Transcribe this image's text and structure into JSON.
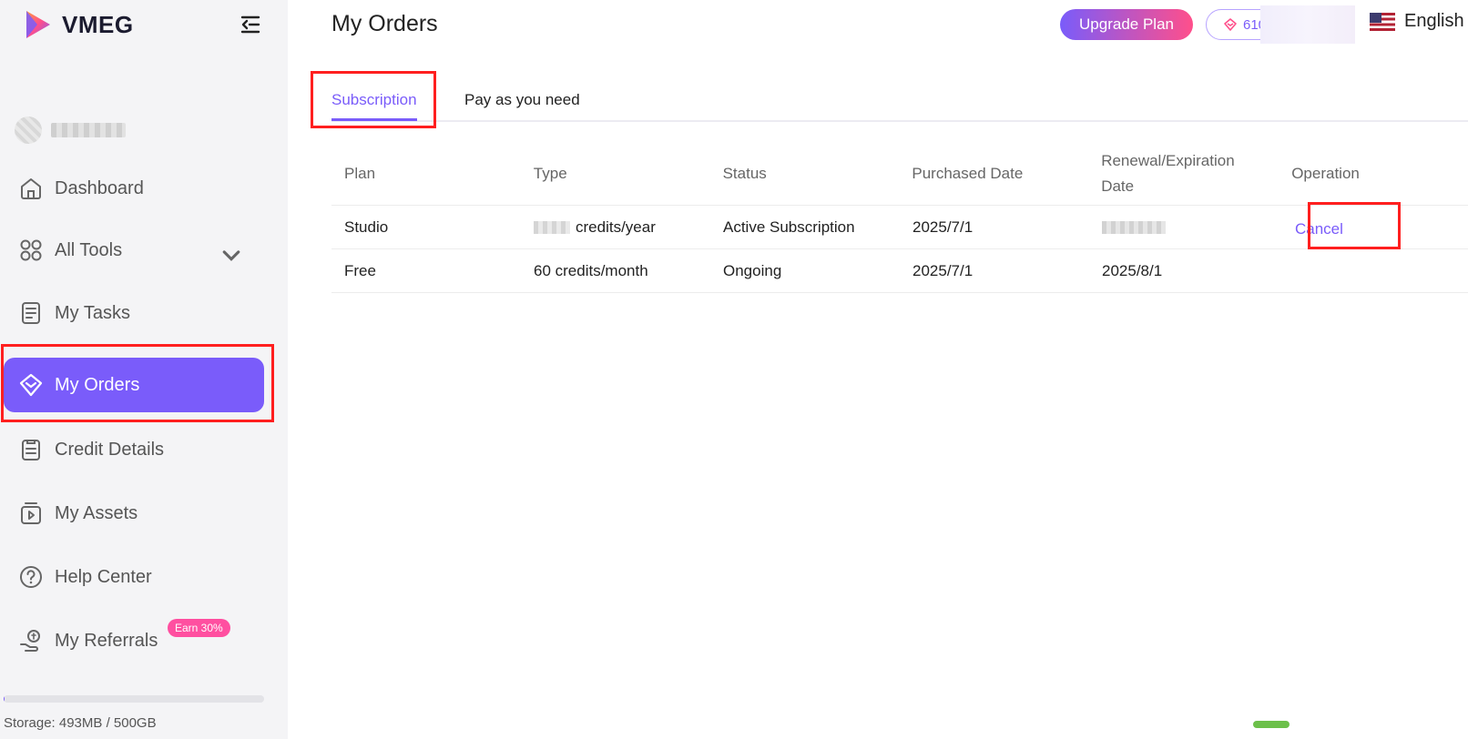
{
  "app": {
    "name": "VMEG"
  },
  "sidebar": {
    "items": [
      {
        "label": "Dashboard",
        "icon": "home-icon"
      },
      {
        "label": "All Tools",
        "icon": "grid-icon"
      },
      {
        "label": "My Tasks",
        "icon": "tasks-icon"
      },
      {
        "label": "My Orders",
        "icon": "diamond-icon",
        "active": true
      },
      {
        "label": "Credit Details",
        "icon": "clipboard-icon"
      },
      {
        "label": "My Assets",
        "icon": "media-icon"
      },
      {
        "label": "Help Center",
        "icon": "help-icon"
      },
      {
        "label": "My Referrals",
        "icon": "referral-icon",
        "badge": "Earn 30%"
      }
    ],
    "storage": {
      "text": "Storage: 493MB / 500GB",
      "fraction": 0.001
    }
  },
  "header": {
    "title": "My Orders",
    "upgrade_label": "Upgrade Plan",
    "credits_value": "610",
    "language": "English"
  },
  "tabs": [
    {
      "label": "Subscription",
      "active": true
    },
    {
      "label": "Pay as you need",
      "active": false
    }
  ],
  "table": {
    "columns": [
      "Plan",
      "Type",
      "Status",
      "Purchased Date",
      "Renewal/Expiration Date",
      "Operation"
    ],
    "rows": [
      {
        "plan": "Studio",
        "type": "credits/year",
        "status": "Active Subscription",
        "purchased": "2025/7/1",
        "renewal": "",
        "operation": "Cancel"
      },
      {
        "plan": "Free",
        "type": "60 credits/month",
        "status": "Ongoing",
        "purchased": "2025/7/1",
        "renewal": "2025/8/1",
        "operation": ""
      }
    ]
  },
  "colors": {
    "accent": "#7a5cfa",
    "pink": "#ff4f8b",
    "highlight": "#ff1f1f"
  }
}
